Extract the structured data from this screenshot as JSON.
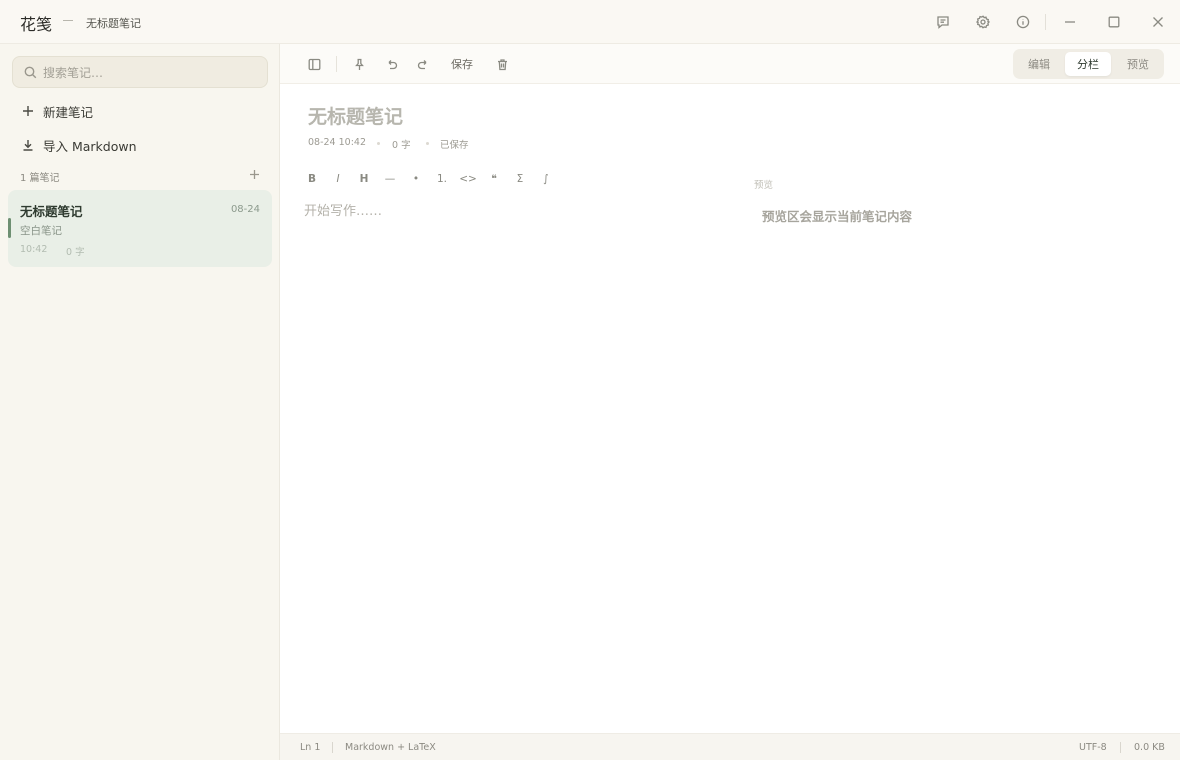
{
  "titlebar": {
    "app_name": "花笺",
    "doc_title": "无标题笔记",
    "icons": [
      "feedback-icon",
      "gear-icon",
      "info-icon",
      "minimize-icon",
      "maximize-icon",
      "close-icon"
    ]
  },
  "sidebar": {
    "search_placeholder": "搜索笔记…",
    "new_note": "新建笔记",
    "import_markdown": "导入 Markdown",
    "notes_count": "1 篇笔记",
    "notes": [
      {
        "title": "无标题笔记",
        "date": "08-24",
        "preview": "空白笔记",
        "time": "10:42",
        "words": "0 字"
      }
    ]
  },
  "toolbar": {
    "save_label": "保存",
    "icons": [
      "sidebar-toggle-icon",
      "pin-icon",
      "undo-icon",
      "redo-icon",
      "trash-icon"
    ],
    "modes": [
      "编辑",
      "分栏",
      "预览"
    ],
    "active_mode": "分栏"
  },
  "note": {
    "title": "无标题笔记",
    "datetime": "08-24 10:42",
    "words": "0 字",
    "save_status": "已保存"
  },
  "format_bar": [
    "B",
    "I",
    "H",
    "—",
    "•",
    "1.",
    "<>",
    "❝",
    "Σ",
    "∫"
  ],
  "editor": {
    "placeholder": "开始写作……"
  },
  "preview": {
    "label": "预览",
    "empty_text": "预览区会显示当前笔记内容"
  },
  "statusbar": {
    "line": "Ln 1",
    "mode": "Markdown + LaTeX",
    "encoding": "UTF-8",
    "size": "0.0 KB"
  },
  "colors": {
    "accent": "#6e8f72",
    "selected_note_bg": "#e9efe7",
    "sidebar_bg": "#f8f6ef",
    "app_bg": "#faf8f3"
  }
}
